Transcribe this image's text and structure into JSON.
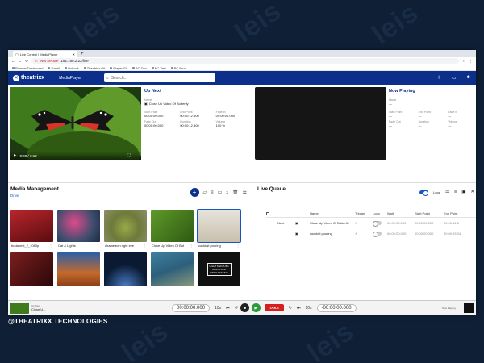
{
  "browser": {
    "tab_title": "Live Control | MediaPlayer",
    "security": "Not Secure",
    "url": "192.168.2.22/live",
    "bookmarks": [
      "Planner Dashboard",
      "Gmail",
      "Outlook",
      "Theatrixx Git",
      "Player Git",
      "BC Dev",
      "BC Test",
      "BC Prod"
    ]
  },
  "app": {
    "logo_text": "theatrixx",
    "app_name": "MediaPlayer",
    "search_placeholder": "Search..."
  },
  "up_next": {
    "title": "Up Next",
    "name_label": "Name",
    "name_value": "Close Up Video Of Butterfly",
    "fields": [
      {
        "label": "Start Point",
        "value": "00:00:00.000"
      },
      {
        "label": "End Point",
        "value": "00:00:12.800"
      },
      {
        "label": "Fade In",
        "value": "00:00:00.000"
      },
      {
        "label": "Fade Out",
        "value": "00:00:00.000"
      },
      {
        "label": "Duration",
        "value": "00:00:12.800"
      },
      {
        "label": "Volume",
        "value": "100 %"
      }
    ],
    "video_time": "0:00 / 0:12"
  },
  "now_playing": {
    "title": "Now Playing",
    "name_label": "Name",
    "name_value": "---",
    "fields": [
      {
        "label": "Start Point",
        "value": "---"
      },
      {
        "label": "End Point",
        "value": "---"
      },
      {
        "label": "Fade In",
        "value": "---"
      },
      {
        "label": "Fade Out",
        "value": "---"
      },
      {
        "label": "Duration",
        "value": "---"
      },
      {
        "label": "Volume",
        "value": "---"
      }
    ]
  },
  "media": {
    "title": "Media Management",
    "source": "Drive",
    "items": [
      {
        "name": "budapest_2_1080p",
        "color": "#b8262c"
      },
      {
        "name": "Cat & Lights",
        "color": "#3b4d6e"
      },
      {
        "name": "chameleon right eye",
        "color": "#6d7a3a"
      },
      {
        "name": "Close Up Video Of But",
        "color": "#3f7a1c"
      },
      {
        "name": "cocktail pouring",
        "color": "#d8d2c8"
      },
      {
        "name": "",
        "color": "#5a1a1a"
      },
      {
        "name": "",
        "color": "#c46a2d"
      },
      {
        "name": "",
        "color": "#0b1a33"
      },
      {
        "name": "",
        "color": "#2d5f7c"
      },
      {
        "name": "",
        "color": "#111111"
      }
    ],
    "last_thumb_text": "LIGHT MEDIA BG IMAGE FOR VIDEO TESTING"
  },
  "queue": {
    "title": "Live Queue",
    "loop_label": "Loop",
    "columns": [
      "",
      "",
      "",
      "Name",
      "Trigger",
      "Loop",
      "Wait",
      "Start Point",
      "End Point"
    ],
    "rows": [
      {
        "status": "Next",
        "name": "Close Up Video Of Butterfly",
        "wait": "00:00:00.000",
        "start": "00:00:00.000",
        "end": "00:00:12.8"
      },
      {
        "status": "",
        "name": "cocktail pouring",
        "wait": "00:00:00.000",
        "start": "00:00:00.000",
        "end": "00:00:25.04"
      }
    ]
  },
  "transport": {
    "up_next_label": "Up Next",
    "up_next_name": "Close U...",
    "elapsed": "00:00:00.000",
    "skip_back": "10s",
    "take": "TAKE",
    "skip_fwd": "10s",
    "remaining": "-00:00:00.000",
    "now_playing_label": "Now Playing"
  },
  "caption": "@THEATRIXX TECHNOLOGIES",
  "watermark": "leis",
  "colors": {
    "brand": "#0d2f8c",
    "take": "#d62020",
    "accent": "#1557c0"
  }
}
